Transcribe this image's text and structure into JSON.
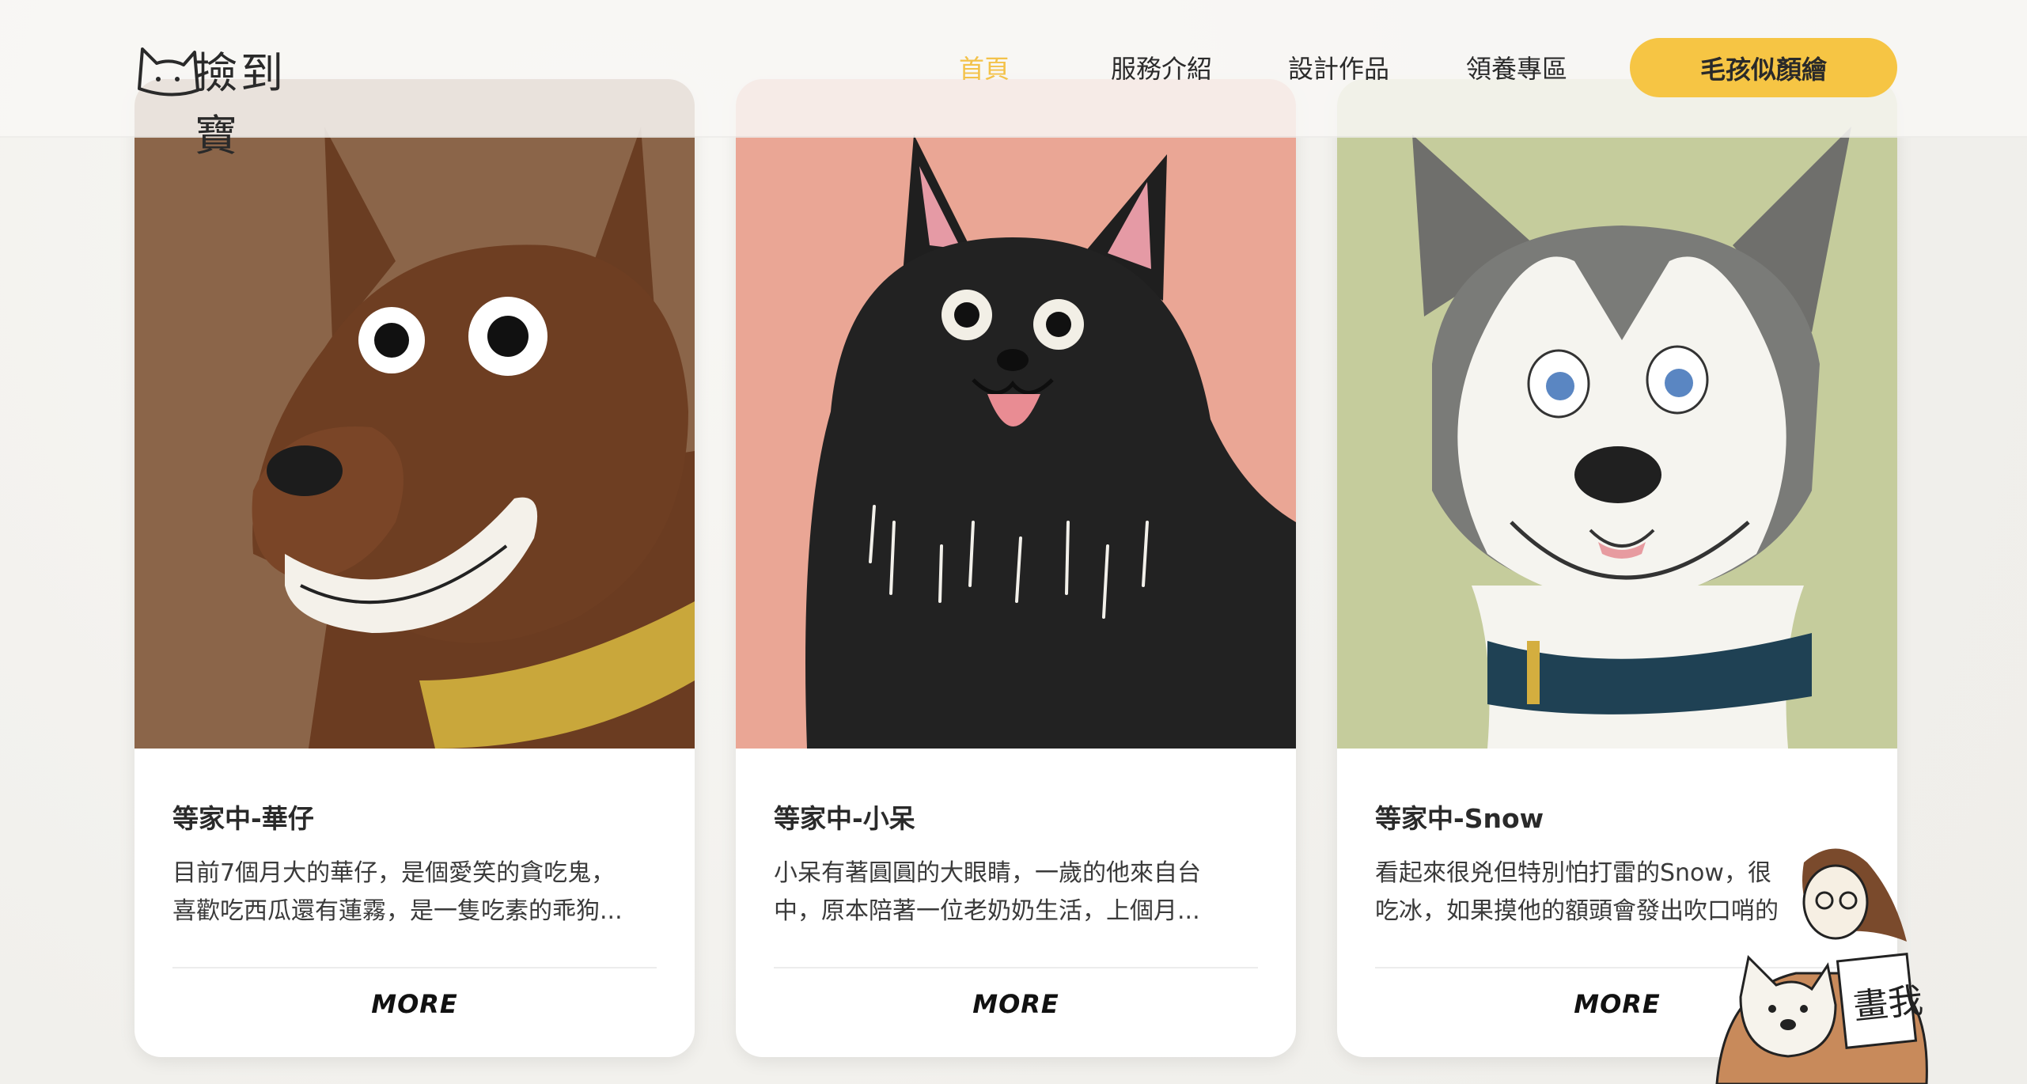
{
  "brand": {
    "logo_text": "撿到寶"
  },
  "nav": {
    "items": [
      {
        "label": "首頁",
        "active": true
      },
      {
        "label": "服務介紹",
        "active": false
      },
      {
        "label": "設計作品",
        "active": false
      },
      {
        "label": "領養專區",
        "active": false
      }
    ],
    "cta_label": "毛孩似顏繪"
  },
  "cards": [
    {
      "title": "等家中-華仔",
      "desc_line1": "目前7個月大的華仔，是個愛笑的貪吃鬼，",
      "desc_line2": "喜歡吃西瓜還有蓮霧，是一隻吃素的乖狗...",
      "more_label": "MORE",
      "bg_color": "#8b6549"
    },
    {
      "title": "等家中-小呆",
      "desc_line1": "小呆有著圓圓的大眼睛，一歲的他來自台",
      "desc_line2": "中，原本陪著一位老奶奶生活，上個月...",
      "more_label": "MORE",
      "bg_color": "#eaa695"
    },
    {
      "title": "等家中-Snow",
      "desc_line1": "看起來很兇但特別怕打雷的Snow，很",
      "desc_line2": "吃冰，如果摸他的額頭會發出吹口哨的",
      "more_label": "MORE",
      "bg_color": "#c5cc9c"
    }
  ],
  "sticker": {
    "sign_text": "畫我"
  },
  "colors": {
    "accent": "#f6c544",
    "nav_active": "#f3c24a"
  }
}
